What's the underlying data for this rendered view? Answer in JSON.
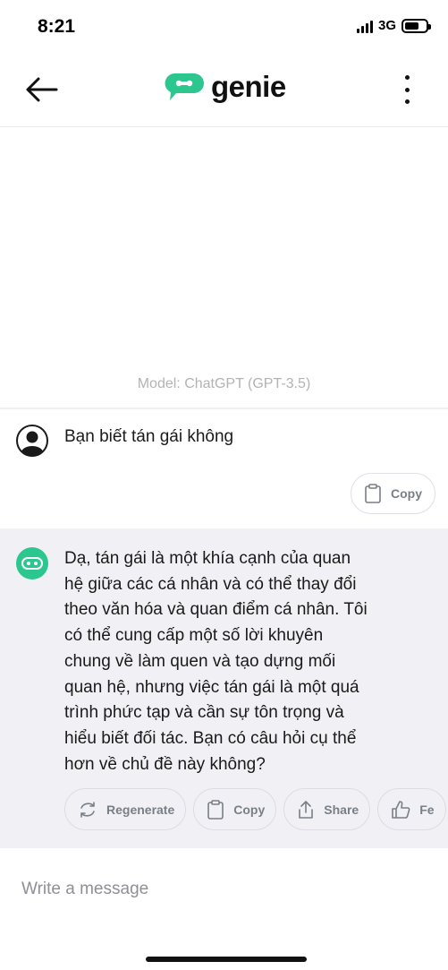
{
  "status_bar": {
    "time": "8:21",
    "network": "3G",
    "battery_level": 0.7
  },
  "header": {
    "logo_text": "genie",
    "brand_color": "#2cc78e",
    "icons": [
      "arrow-left-icon",
      "genie-logo-icon",
      "more-vertical-icon"
    ]
  },
  "chat": {
    "model_label": "Model: ChatGPT (GPT-3.5)",
    "user_message": {
      "text": "Bạn biết tán gái không",
      "copy_label": "Copy"
    },
    "bot_message": {
      "lines": [
        "Dạ, tán gái là một khía cạnh của quan",
        "hệ giữa các cá nhân và có thể thay đổi",
        "theo văn hóa và quan điểm cá nhân. Tôi",
        "có thể cung cấp một số lời khuyên",
        "chung về làm quen và tạo dựng mối",
        "quan hệ, nhưng việc tán gái là một quá",
        "trình phức tạp và cần sự tôn trọng và",
        "hiểu biết đối tác. Bạn có câu hỏi cụ thể",
        "hơn về chủ đề này không?"
      ],
      "actions": {
        "regenerate": "Regenerate",
        "copy": "Copy",
        "share": "Share",
        "feedback": "Fe"
      }
    }
  },
  "composer": {
    "placeholder": "Write a message"
  }
}
